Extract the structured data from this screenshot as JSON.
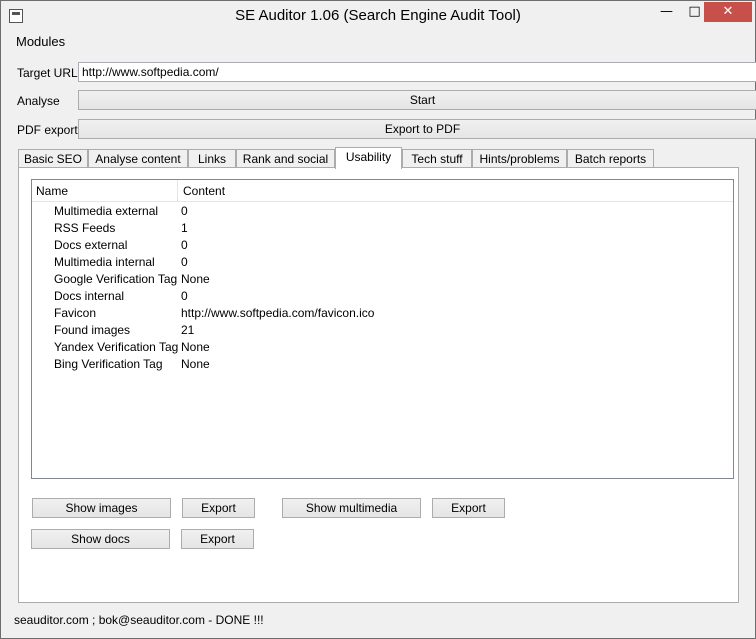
{
  "window": {
    "title": "SE Auditor 1.06 (Search Engine Audit Tool)",
    "min": "—",
    "max": "□",
    "close": "✕"
  },
  "menu": {
    "items": [
      {
        "label": "Modules"
      }
    ]
  },
  "form": {
    "target_url_label": "Target URL",
    "target_url_value": "http://www.softpedia.com/",
    "analyse_label": "Analyse",
    "start_button": "Start",
    "pdf_label": "PDF export",
    "export_pdf_button": "Export to PDF"
  },
  "tabs": [
    {
      "label": "Basic SEO"
    },
    {
      "label": "Analyse content"
    },
    {
      "label": "Links"
    },
    {
      "label": "Rank and social"
    },
    {
      "label": "Usability"
    },
    {
      "label": "Tech stuff"
    },
    {
      "label": "Hints/problems"
    },
    {
      "label": "Batch reports"
    }
  ],
  "active_tab": "Usability",
  "table": {
    "columns": [
      "Name",
      "Content"
    ],
    "rows": [
      {
        "name": "Multimedia external",
        "content": "0"
      },
      {
        "name": "RSS Feeds",
        "content": "1"
      },
      {
        "name": "Docs external",
        "content": "0"
      },
      {
        "name": "Multimedia internal",
        "content": "0"
      },
      {
        "name": "Google Verification Tag",
        "content": "None"
      },
      {
        "name": "Docs internal",
        "content": "0"
      },
      {
        "name": "Favicon",
        "content": "http://www.softpedia.com/favicon.ico"
      },
      {
        "name": "Found images",
        "content": "21"
      },
      {
        "name": "Yandex Verification Tag",
        "content": "None"
      },
      {
        "name": "Bing Verification Tag",
        "content": "None"
      }
    ]
  },
  "actions": {
    "show_images": "Show images",
    "export_images": "Export",
    "show_multimedia": "Show multimedia",
    "export_multimedia": "Export",
    "show_docs": "Show docs",
    "export_docs": "Export"
  },
  "status": "seauditor.com ; bok@seauditor.com - DONE !!!",
  "colors": {
    "close_button": "#c7504b",
    "border": "#acacac",
    "window_bg": "#f0f0f0"
  }
}
